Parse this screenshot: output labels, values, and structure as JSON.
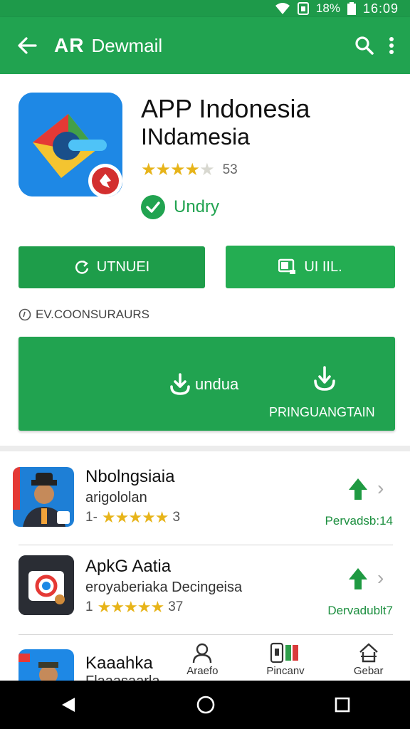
{
  "status_bar": {
    "battery": "18%",
    "time": "16:09"
  },
  "app_bar": {
    "logo": "AR",
    "title": "Dewmail"
  },
  "app": {
    "name": "APP Indonesia",
    "subtitle": "INdamesia",
    "rating_count": "53",
    "rating_stars": 4,
    "verified_label": "Undry"
  },
  "buttons": {
    "left_label": "UTNUEI",
    "right_label": "UI IIL."
  },
  "section": {
    "label": "EV.COONSURAURS"
  },
  "download": {
    "label": "undua",
    "sub_label": "PRINGUANGTAIN"
  },
  "list": [
    {
      "name": "Nbolngsiaia",
      "developer": "arigololan",
      "rating_prefix": "1-",
      "rating_count": "3",
      "download_text": "Pervadsb:14"
    },
    {
      "name": "ApkG Aatia",
      "developer": "eroyaberiaka Decingeisa",
      "rating_prefix": "1",
      "rating_count": "37",
      "download_text": "Dervadublt7"
    },
    {
      "name": "Kaaahka",
      "developer": "Flaaasaarla",
      "rating_prefix": "",
      "rating_count": "",
      "download_text": ""
    }
  ],
  "bottom_tabs": [
    {
      "label": "Araefo",
      "icon": "person-icon"
    },
    {
      "label": "Pincanv",
      "icon": "device-icon"
    },
    {
      "label": "Gebar",
      "icon": "home-icon"
    }
  ],
  "colors": {
    "primary": "#21a350",
    "accent_star": "#e7b41a"
  }
}
